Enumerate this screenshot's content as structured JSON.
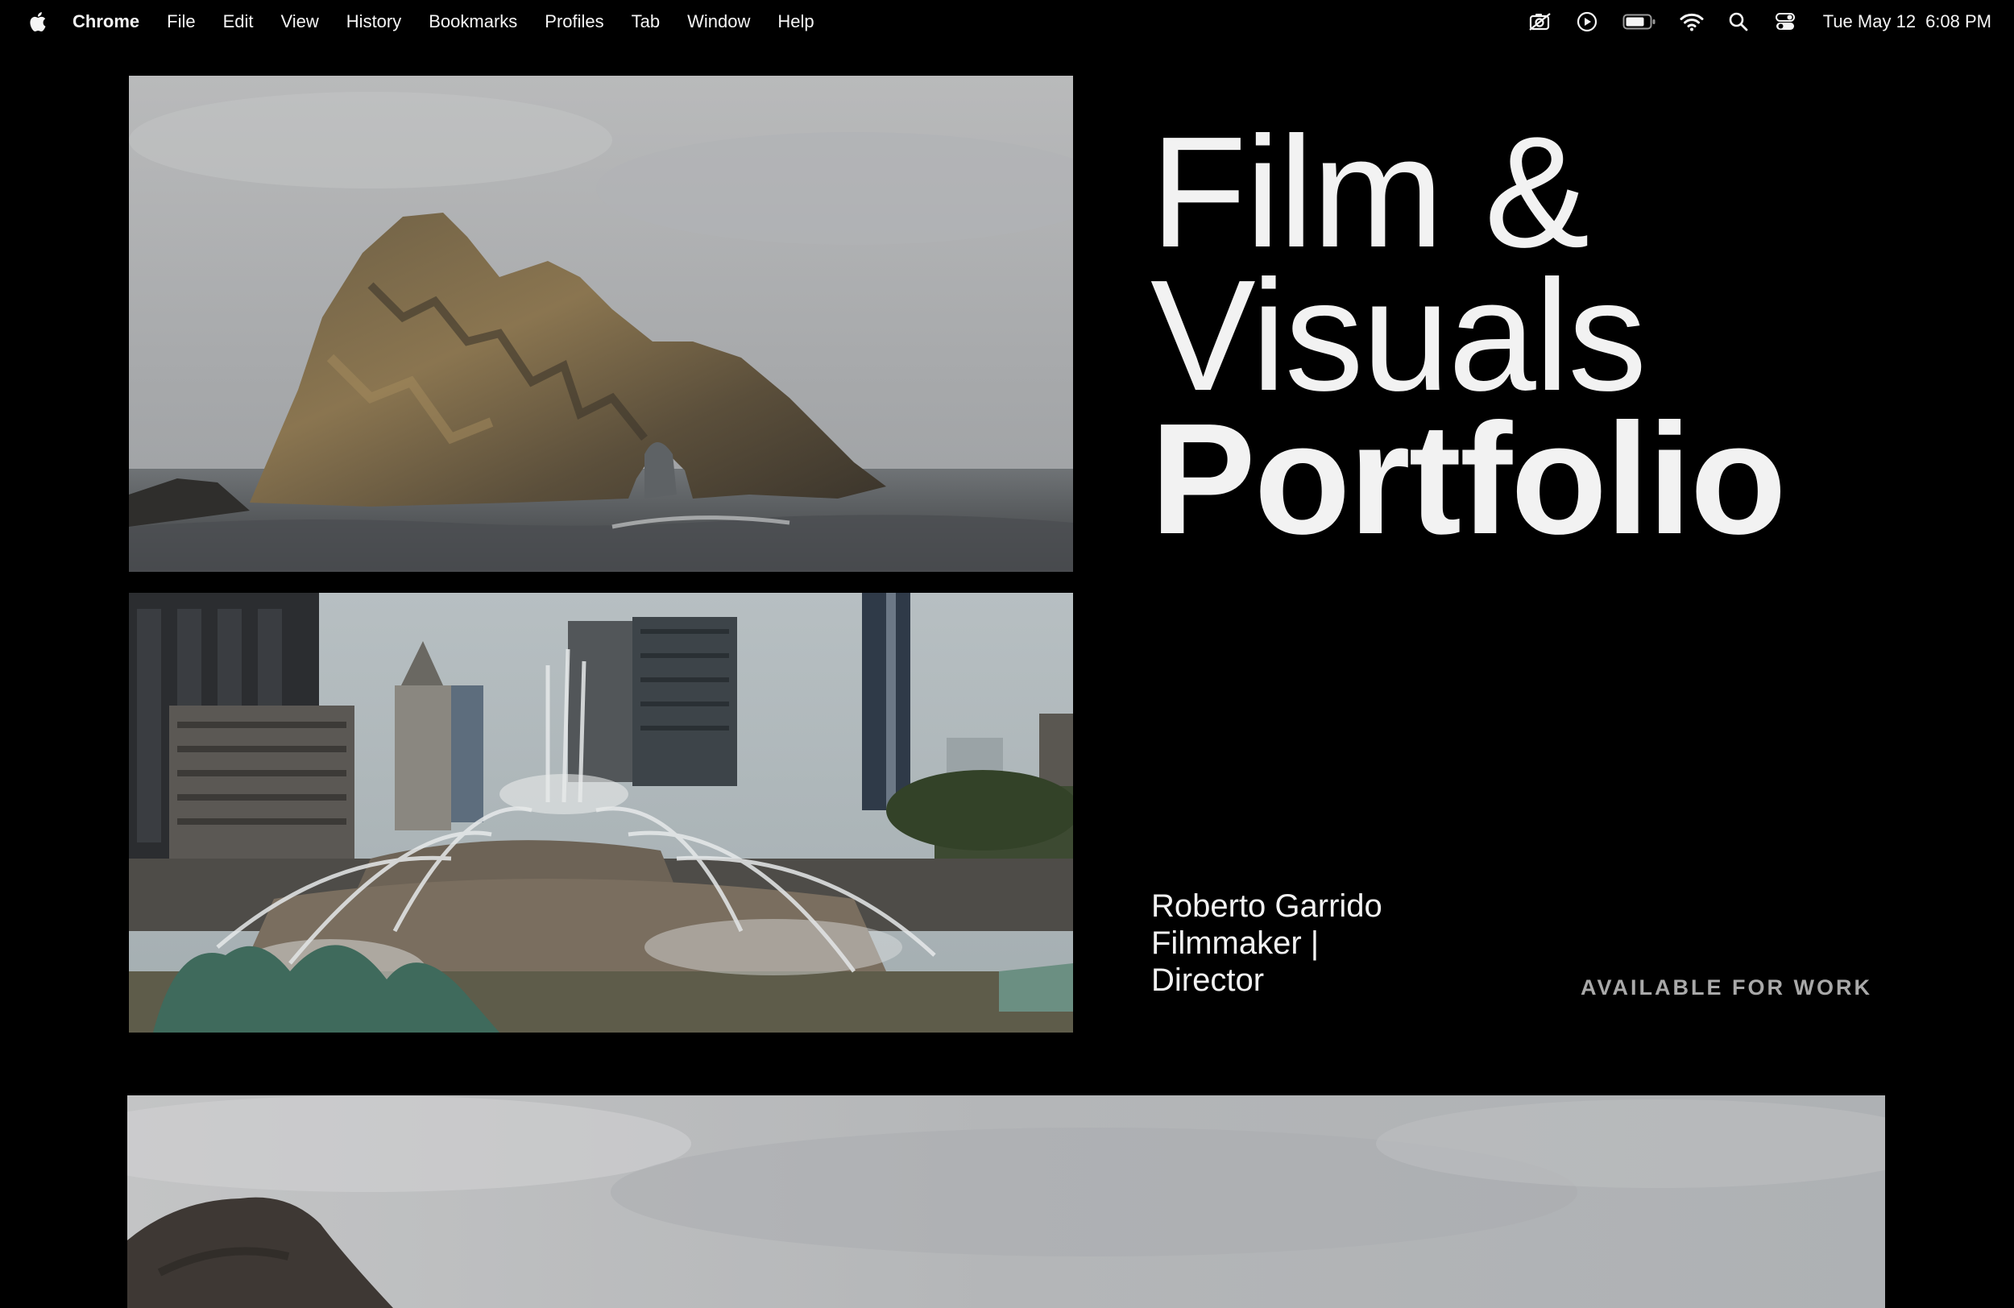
{
  "menubar": {
    "apple_icon": "apple-logo-icon",
    "items": [
      "Chrome",
      "File",
      "Edit",
      "View",
      "History",
      "Bookmarks",
      "Profiles",
      "Tab",
      "Window",
      "Help"
    ],
    "status_icons": [
      "screen-recording-icon",
      "now-playing-icon",
      "battery-icon",
      "wifi-icon",
      "spotlight-search-icon",
      "control-center-icon"
    ],
    "date": "Tue May 12",
    "time": "6:08 PM"
  },
  "hero": {
    "line1": "Film &",
    "line2": "Visuals",
    "line3": "Portfolio"
  },
  "person": {
    "name": "Roberto Garrido",
    "role_line1": "Filmmaker |",
    "role_line2": "Director"
  },
  "status": {
    "availability": "AVAILABLE FOR WORK"
  }
}
